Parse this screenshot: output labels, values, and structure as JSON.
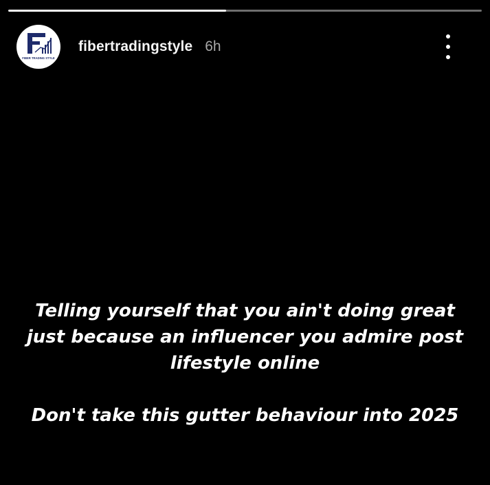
{
  "story": {
    "progress_fraction": 0.46,
    "username": "fibertradingstyle",
    "time_ago": "6h",
    "avatar": {
      "logo_letter": "F",
      "logo_tagline": "FIBER TRADING STYLE",
      "brand_color": "#1e2b6b"
    },
    "menu_icon": "more-vertical-icon",
    "text": {
      "line1": "Telling yourself that you ain't doing great",
      "line2": "just because an influencer you admire post",
      "line3": "lifestyle online",
      "line4": "Don't take this gutter behaviour into 2025"
    }
  }
}
